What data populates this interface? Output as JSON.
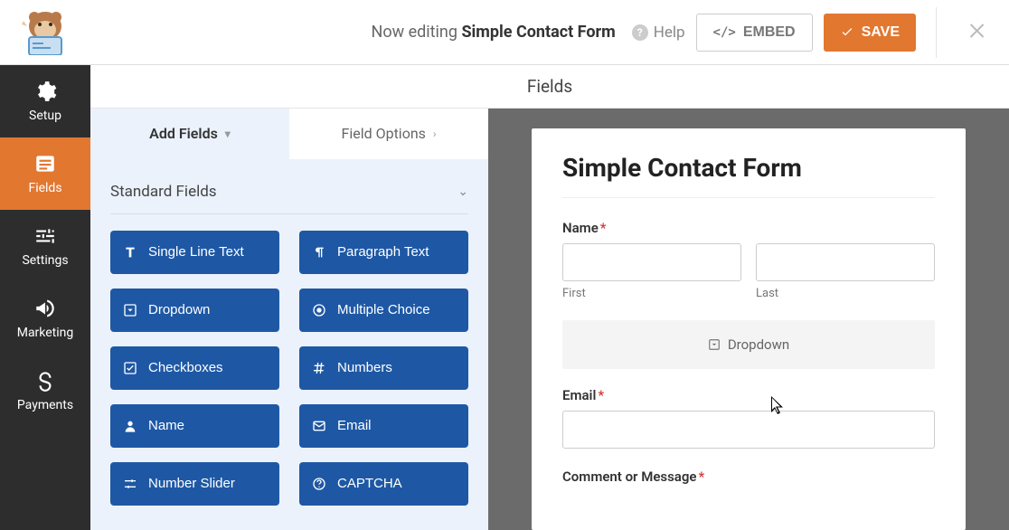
{
  "header": {
    "editing_prefix": "Now editing",
    "form_name": "Simple Contact Form",
    "help_label": "Help",
    "embed_label": "EMBED",
    "save_label": "SAVE"
  },
  "nav": {
    "items": [
      {
        "label": "Setup",
        "icon": "gear"
      },
      {
        "label": "Fields",
        "icon": "form"
      },
      {
        "label": "Settings",
        "icon": "sliders"
      },
      {
        "label": "Marketing",
        "icon": "megaphone"
      },
      {
        "label": "Payments",
        "icon": "dollar"
      }
    ],
    "active_index": 1
  },
  "section_title": "Fields",
  "palette": {
    "tabs": {
      "add": "Add Fields",
      "options": "Field Options"
    },
    "group_title": "Standard Fields",
    "fields": [
      {
        "label": "Single Line Text",
        "icon": "text"
      },
      {
        "label": "Paragraph Text",
        "icon": "paragraph"
      },
      {
        "label": "Dropdown",
        "icon": "caret"
      },
      {
        "label": "Multiple Choice",
        "icon": "radio"
      },
      {
        "label": "Checkboxes",
        "icon": "check"
      },
      {
        "label": "Numbers",
        "icon": "hash"
      },
      {
        "label": "Name",
        "icon": "user"
      },
      {
        "label": "Email",
        "icon": "mail"
      },
      {
        "label": "Number Slider",
        "icon": "sliders"
      },
      {
        "label": "CAPTCHA",
        "icon": "help"
      }
    ]
  },
  "preview": {
    "form_title": "Simple Contact Form",
    "name_label": "Name",
    "first_sublabel": "First",
    "last_sublabel": "Last",
    "dropdown_placeholder": "Dropdown",
    "email_label": "Email",
    "comment_label": "Comment or Message",
    "required_mark": "*"
  }
}
